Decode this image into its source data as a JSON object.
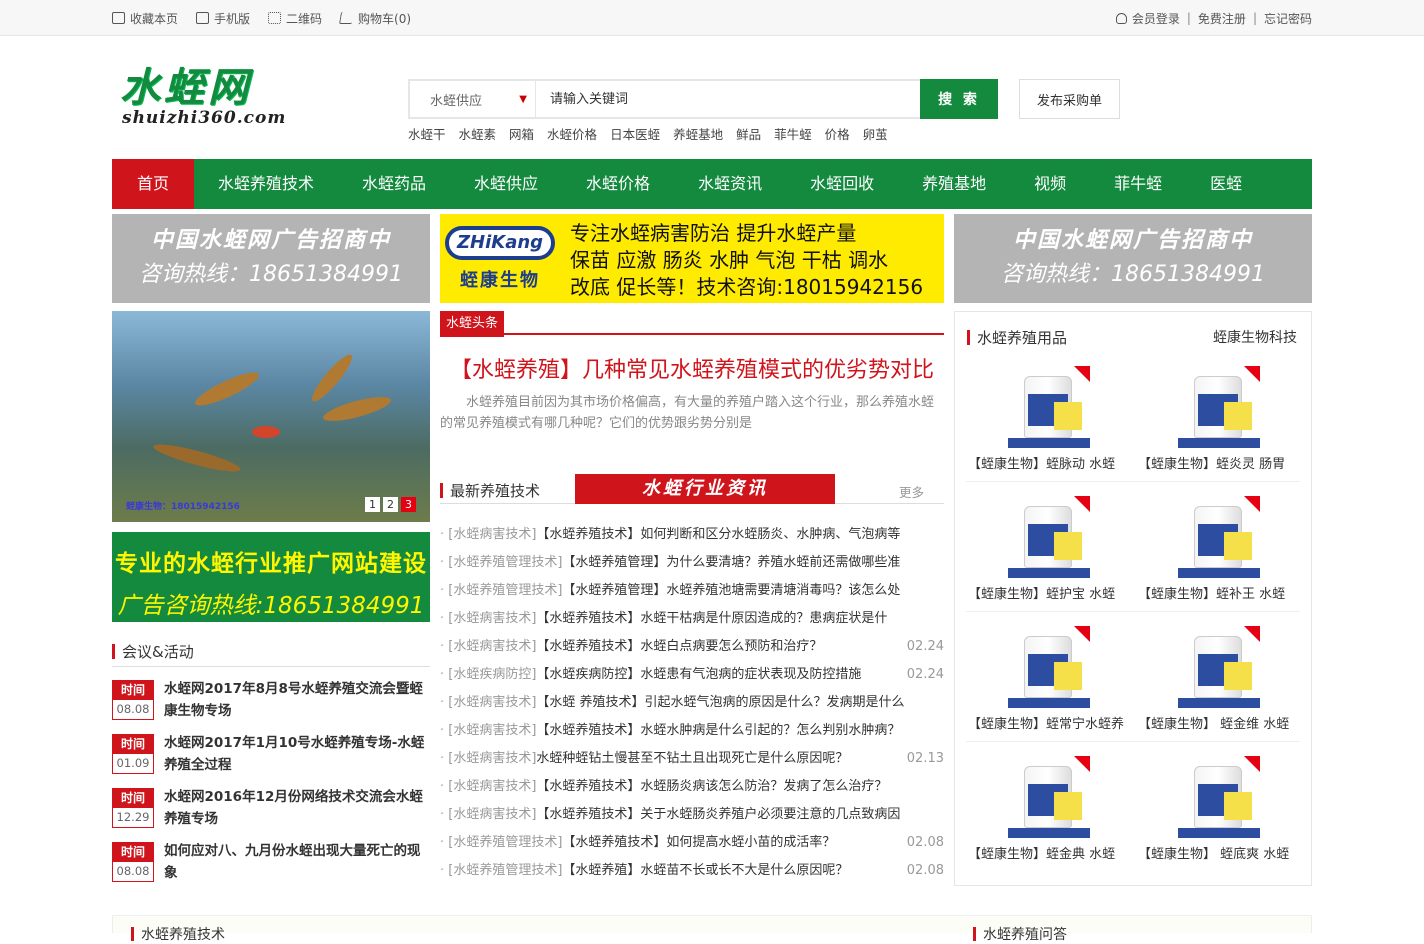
{
  "topbar": {
    "left": [
      {
        "icon": "bookmark-icon",
        "label": "收藏本页"
      },
      {
        "icon": "mobile-icon",
        "label": "手机版"
      },
      {
        "icon": "qrcode-icon",
        "label": "二维码"
      },
      {
        "icon": "cart-icon",
        "label": "购物车(0)"
      }
    ],
    "login": "会员登录",
    "register": "免费注册",
    "forgot": "忘记密码"
  },
  "logo": {
    "cn": "水蛭网",
    "en": "shuizhi360.com"
  },
  "search": {
    "category": "水蛭供应",
    "placeholder": "请输入关键词",
    "button": "搜 索",
    "publish": "发布采购单",
    "hot": [
      "水蛭干",
      "水蛭素",
      "网箱",
      "水蛭价格",
      "日本医蛭",
      "养蛭基地",
      "鲜品",
      "菲牛蛭",
      "价格",
      "卵茧"
    ]
  },
  "nav": [
    "首页",
    "水蛭养殖技术",
    "水蛭药品",
    "水蛭供应",
    "水蛭价格",
    "水蛭资讯",
    "水蛭回收",
    "养殖基地",
    "视频",
    "菲牛蛭",
    "医蛭"
  ],
  "ads": {
    "left": {
      "l1": "中国水蛭网广告招商中",
      "l2": "咨询热线：18651384991"
    },
    "center": {
      "logo": "ZHiKang",
      "brand": "蛭康生物",
      "lines": [
        "专注水蛭病害防治 提升水蛭产量",
        "保苗 应激 肠炎 水肿 气泡 干枯 调水",
        "改底 促长等！技术咨询:18015942156"
      ]
    },
    "right": {
      "l1": "中国水蛭网广告招商中",
      "l2": "咨询热线：18651384991"
    },
    "green": {
      "l1": "专业的水蛭行业推广网站建设",
      "l2": "广告咨询热线:18651384991"
    }
  },
  "slider": {
    "caption": "蛭康生物：18015942156",
    "pages": [
      "1",
      "2",
      "3"
    ],
    "active": 3
  },
  "meetings": {
    "title": "会议&活动",
    "date_label": "时间",
    "items": [
      {
        "date": "08.08",
        "title": "水蛭网2017年8月8号水蛭养殖交流会暨蛭康生物专场"
      },
      {
        "date": "01.09",
        "title": "水蛭网2017年1月10号水蛭养殖专场-水蛭养殖全过程"
      },
      {
        "date": "12.29",
        "title": "水蛭网2016年12月份网络技术交流会水蛭养殖专场"
      },
      {
        "date": "08.08",
        "title": "如何应对八、九月份水蛭出现大量死亡的现象"
      }
    ]
  },
  "headline": {
    "tag": "水蛭头条",
    "title": "【水蛭养殖】几种常见水蛭养殖模式的优劣势对比",
    "summary": "水蛭养殖目前因为其市场价格偏高，有大量的养殖户踏入这个行业，那么养殖水蛭的常见养殖模式有哪几种呢？它们的优势跟劣势分别是"
  },
  "newslist": {
    "title": "最新养殖技术",
    "banner": "水蛭行业资讯",
    "more": "更多",
    "items": [
      {
        "cat": "[水蛭病害技术]",
        "title": "【水蛭养殖技术】如何判断和区分水蛭肠炎、水肿病、气泡病等",
        "date": ""
      },
      {
        "cat": "[水蛭养殖管理技术]",
        "title": "【水蛭养殖管理】为什么要清塘？养殖水蛭前还需做哪些准",
        "date": ""
      },
      {
        "cat": "[水蛭养殖管理技术]",
        "title": "【水蛭养殖管理】水蛭养殖池塘需要清塘消毒吗？该怎么处",
        "date": ""
      },
      {
        "cat": "[水蛭病害技术]",
        "title": "【水蛭养殖技术】水蛭干枯病是什原因造成的？患病症状是什",
        "date": ""
      },
      {
        "cat": "[水蛭病害技术]",
        "title": "【水蛭养殖技术】水蛭白点病要怎么预防和治疗？",
        "date": "02.24"
      },
      {
        "cat": "[水蛭疾病防控]",
        "title": "【水蛭疾病防控】水蛭患有气泡病的症状表现及防控措施",
        "date": "02.24"
      },
      {
        "cat": "[水蛭病害技术]",
        "title": "【水蛭 养殖技术】引起水蛭气泡病的原因是什么？发病期是什么",
        "date": ""
      },
      {
        "cat": "[水蛭病害技术]",
        "title": "【水蛭养殖技术】水蛭水肿病是什么引起的？怎么判别水肿病？",
        "date": ""
      },
      {
        "cat": "[水蛭病害技术]",
        "title": "水蛭种蛭钻土慢甚至不钻土且出现死亡是什么原因呢？",
        "date": "02.13"
      },
      {
        "cat": "[水蛭病害技术]",
        "title": "【水蛭养殖技术】水蛭肠炎病该怎么防治？发病了怎么治疗？",
        "date": ""
      },
      {
        "cat": "[水蛭病害技术]",
        "title": "【水蛭养殖技术】关于水蛭肠炎养殖户必须要注意的几点致病因",
        "date": ""
      },
      {
        "cat": "[水蛭养殖管理技术]",
        "title": "【水蛭养殖技术】如何提高水蛭小苗的成活率？",
        "date": "02.08"
      },
      {
        "cat": "[水蛭养殖管理技术]",
        "title": "【水蛭养殖】水蛭苗不长或长不大是什么原因呢？",
        "date": "02.08"
      }
    ]
  },
  "products": {
    "title": "水蛭养殖用品",
    "brand": "蛭康生物科技",
    "items": [
      "【蛭康生物】蛭脉动 水蛭",
      "【蛭康生物】蛭炎灵 肠胃",
      "【蛭康生物】蛭护宝 水蛭",
      "【蛭康生物】蛭补王 水蛭",
      "【蛭康生物】蛭常宁水蛭养",
      "【蛭康生物】 蛭金维 水蛭",
      "【蛭康生物】蛭金典 水蛭",
      "【蛭康生物】 蛭底爽 水蛭"
    ]
  },
  "bottom": {
    "left": "水蛭养殖技术",
    "right": "水蛭养殖问答"
  }
}
